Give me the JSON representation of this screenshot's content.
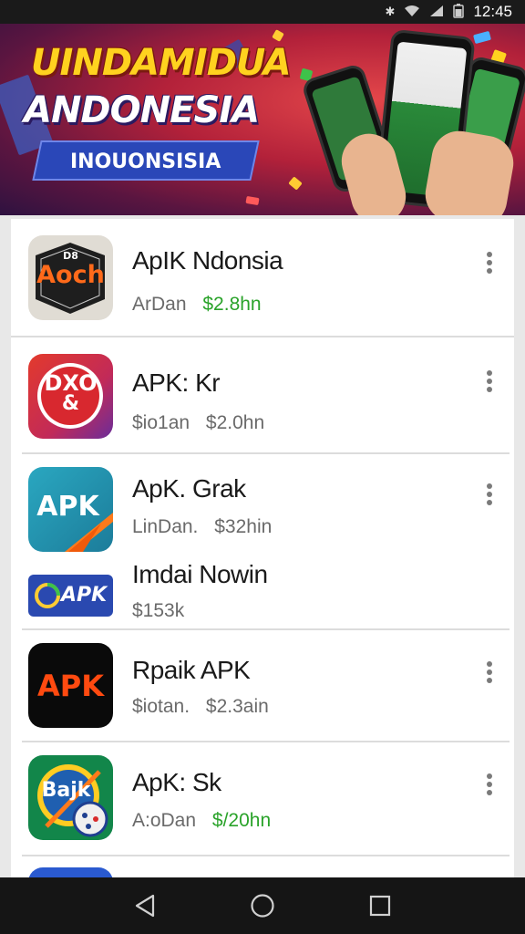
{
  "status_bar": {
    "time": "12:45",
    "icons": [
      "bluetooth-icon",
      "wifi-icon",
      "signal-icon",
      "battery-icon"
    ]
  },
  "banner": {
    "line1": "UINDAMIDUA",
    "line2": "ANDONESIA",
    "pill": "INOUONSISIA"
  },
  "apps": [
    {
      "name": "ApIK Ndonsia",
      "label": "ArDan",
      "price": "$2.8hn",
      "price_color": "#2aa32a",
      "icon_text": "Aoch",
      "icon_badge": "D8"
    },
    {
      "name": "APK: Kr",
      "label": "$io1an",
      "price": "$2.0hn",
      "price_color": "#6a6a6a",
      "icon_text": "DXO",
      "icon_sub": "&"
    },
    {
      "name": "ApK. Grak",
      "label": "LinDan.",
      "price": "$32hin",
      "price_color": "#6a6a6a",
      "icon_text": "APK"
    },
    {
      "name": "Imdai Nowin",
      "label": "$153k",
      "icon_text": "APK"
    },
    {
      "name": "Rpaik APK",
      "label": "$iotan.",
      "price": "$2.3ain",
      "price_color": "#6a6a6a",
      "icon_text": "APK"
    },
    {
      "name": "ApK: Sk",
      "label": "A:oDan",
      "price": "$/20hn",
      "price_color": "#2aa32a",
      "icon_text": "Bajk"
    }
  ],
  "nav": {
    "back": "back-icon",
    "home": "home-icon",
    "recents": "recents-icon"
  }
}
